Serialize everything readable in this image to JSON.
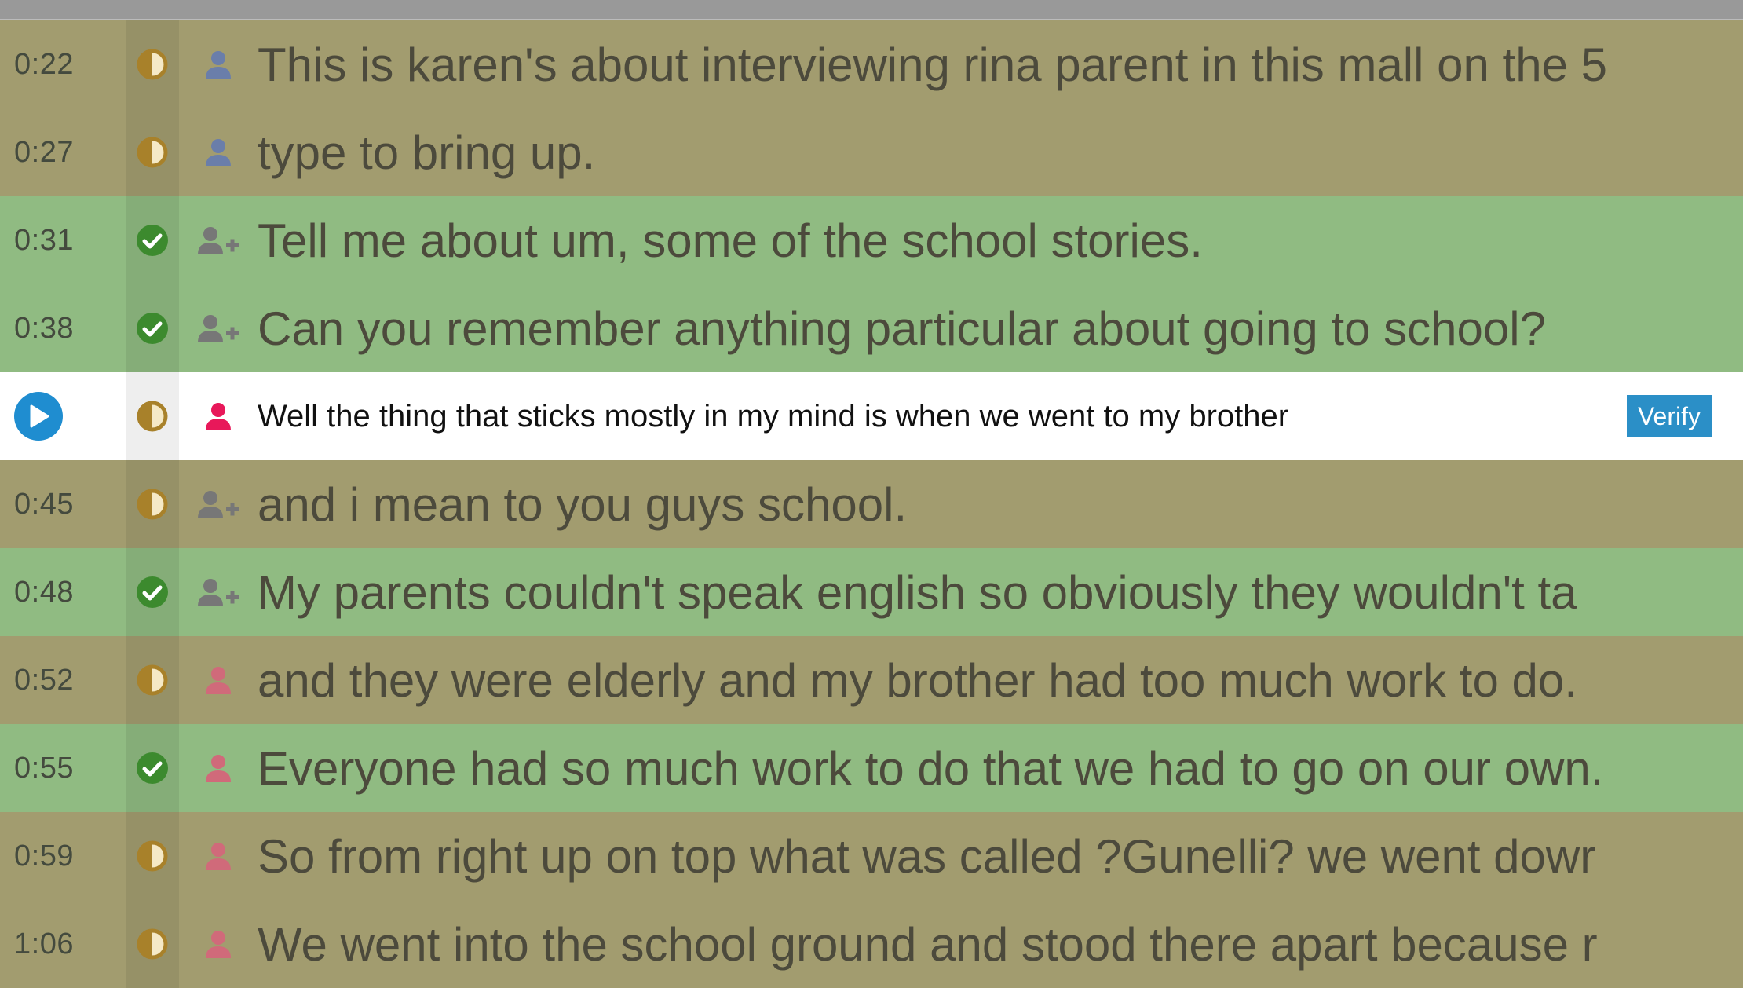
{
  "colors": {
    "partial_row": "#a29c6f",
    "verified_row": "#90bb82",
    "active_row": "#ffffff",
    "speaker_blue": "#6a7eaa",
    "speaker_gray": "#777777",
    "speaker_pink": "#d06a7a",
    "speaker_pink_active": "#e8185a",
    "verify_button": "#2b8fc7"
  },
  "active_row": {
    "play_icon": "play-circle-icon",
    "status_icon": "half-circle-icon",
    "speaker_icon": "person-icon",
    "text": "Well the thing that sticks mostly in my mind is when we went to my brother",
    "verify_label": "Verify"
  },
  "rows": [
    {
      "time": "0:22",
      "status": "partial",
      "speaker_icon": "person-icon",
      "speaker_color": "blue",
      "text": "This is karen's about interviewing rina parent in this mall on the 5"
    },
    {
      "time": "0:27",
      "status": "partial",
      "speaker_icon": "person-icon",
      "speaker_color": "blue",
      "text": "type to bring up."
    },
    {
      "time": "0:31",
      "status": "verified",
      "speaker_icon": "person-plus-icon",
      "speaker_color": "gray",
      "text": "Tell me about um, some of the school stories."
    },
    {
      "time": "0:38",
      "status": "verified",
      "speaker_icon": "person-plus-icon",
      "speaker_color": "gray",
      "text": "Can you remember anything particular about going to school?"
    },
    {
      "time": "0:45",
      "status": "partial",
      "speaker_icon": "person-plus-icon",
      "speaker_color": "gray",
      "text": "and i mean to you guys school."
    },
    {
      "time": "0:48",
      "status": "verified",
      "speaker_icon": "person-plus-icon",
      "speaker_color": "gray",
      "text": "My parents couldn't speak english so obviously they wouldn't ta"
    },
    {
      "time": "0:52",
      "status": "partial",
      "speaker_icon": "person-icon",
      "speaker_color": "pink",
      "text": "and they were elderly and my brother had too much work to do."
    },
    {
      "time": "0:55",
      "status": "verified",
      "speaker_icon": "person-icon",
      "speaker_color": "pink",
      "text": "Everyone had so much work to do that we had to go on our own."
    },
    {
      "time": "0:59",
      "status": "partial",
      "speaker_icon": "person-icon",
      "speaker_color": "pink",
      "text": "So from right up on top what was called ?Gunelli? we went dowr"
    },
    {
      "time": "1:06",
      "status": "partial",
      "speaker_icon": "person-icon",
      "speaker_color": "pink",
      "text": "We went into the school ground and stood there apart because r"
    }
  ]
}
